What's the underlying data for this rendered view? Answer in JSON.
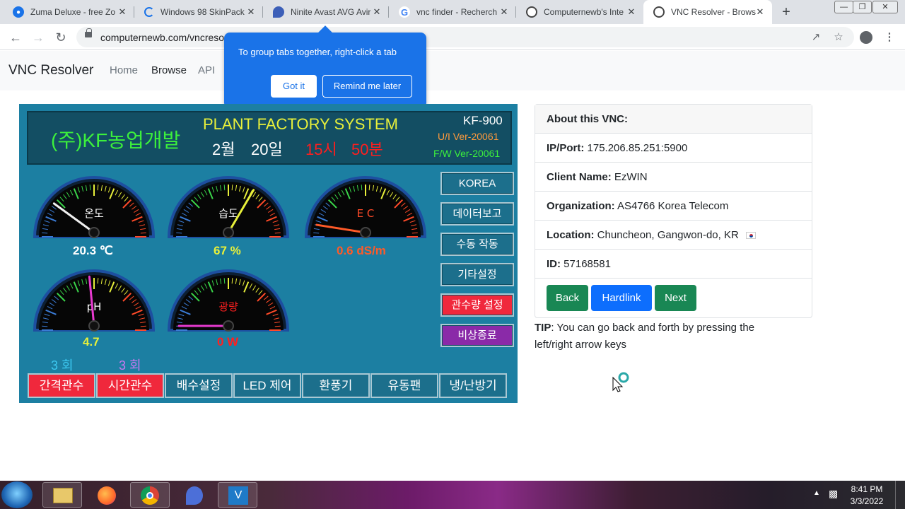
{
  "browser": {
    "tabs": [
      {
        "title": "Zuma Deluxe - free Zo",
        "favicon_color": "#1a73e8",
        "glyph": "●"
      },
      {
        "title": "Windows 98 SkinPack",
        "favicon_color": "#1a73e8",
        "glyph": "◌"
      },
      {
        "title": "Ninite Avast AVG Avir",
        "favicon_color": "#3c5fb8",
        "glyph": "❦"
      },
      {
        "title": "vnc finder - Recherch",
        "favicon_color": "#ffffff",
        "glyph": "G"
      },
      {
        "title": "Computernewb's Inte",
        "favicon_color": "#555555",
        "glyph": "⚙"
      },
      {
        "title": "VNC Resolver - Brows",
        "favicon_color": "#555555",
        "glyph": "⚙"
      }
    ],
    "active_tab": 5,
    "url": "computernewb.com/vncreso"
  },
  "tab_group_popup": {
    "message": "To group tabs together, right-click a tab",
    "got_it": "Got it",
    "remind": "Remind me later"
  },
  "site": {
    "brand": "VNC Resolver",
    "nav": [
      "Home",
      "Browse",
      "API"
    ],
    "active_nav": "Browse"
  },
  "vnc_screen": {
    "company": "(주)KF농업개발",
    "system": "PLANT  FACTORY  SYSTEM",
    "month": "2월",
    "day": "20일",
    "hour": "15시",
    "minute": "50분",
    "model": "KF-900",
    "ui_ver": "U/I Ver-20061",
    "fw_ver": "F/W Ver-20061",
    "gauges": [
      {
        "label": "온도",
        "value": "20.3 ℃",
        "value_color": "#ffffff",
        "needle_color": "#f0f0f0",
        "level": 0.2
      },
      {
        "label": "습도",
        "value": "67 %",
        "value_color": "#e8f03a",
        "needle_color": "#e8f03a",
        "level": 0.67
      },
      {
        "label": "E C",
        "value": "0.6 dS/m",
        "value_color": "#ff5a28",
        "needle_color": "#ff5a28",
        "level": 0.05
      },
      {
        "label": "pH",
        "value": "4.7",
        "value_color": "#e8f03a",
        "needle_color": "#e83ad0",
        "level": 0.47
      },
      {
        "label": "광량",
        "value": "0 W",
        "value_color": "#ff2020",
        "needle_color": "#e83ad0",
        "level": 0.0
      }
    ],
    "side_buttons": [
      "KOREA",
      "데이터보고",
      "수동 작동",
      "기타설정",
      "관수량 설정",
      "비상종료"
    ],
    "counts": [
      "3 회",
      "3 회"
    ],
    "bottom_buttons": [
      "간격관수",
      "시간관수",
      "배수설정",
      "LED 제어",
      "환풍기",
      "유동팬",
      "냉/난방기"
    ]
  },
  "info": {
    "header": "About this VNC:",
    "ip_label": "IP/Port:",
    "ip": "175.206.85.251:5900",
    "client_label": "Client Name:",
    "client": "EzWIN",
    "org_label": "Organization:",
    "org": "AS4766 Korea Telecom",
    "loc_label": "Location:",
    "loc": "Chuncheon, Gangwon-do, KR",
    "id_label": "ID:",
    "id": "57168581",
    "back": "Back",
    "hardlink": "Hardlink",
    "next": "Next",
    "tip_label": "TIP",
    "tip": ": You can go back and forth by pressing the left/right arrow keys"
  },
  "taskbar": {
    "time": "8:41 PM",
    "date": "3/3/2022"
  }
}
